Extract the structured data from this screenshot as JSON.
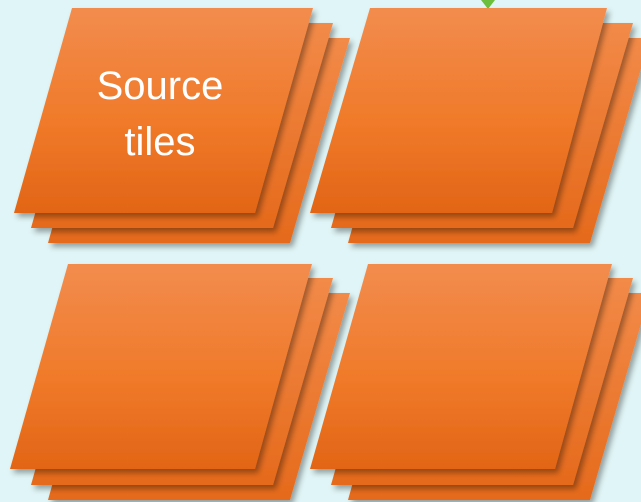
{
  "tiles": [
    {
      "label": "Source\ntiles"
    },
    {
      "label": ""
    },
    {
      "label": ""
    },
    {
      "label": ""
    }
  ],
  "colors": {
    "background": "#e0f5f7",
    "tile_top": "#f28c4e",
    "tile_mid": "#f07a2a",
    "tile_bottom": "#e26516",
    "tile_back": "#f07d2c",
    "arrow": "#6cbf3c"
  }
}
